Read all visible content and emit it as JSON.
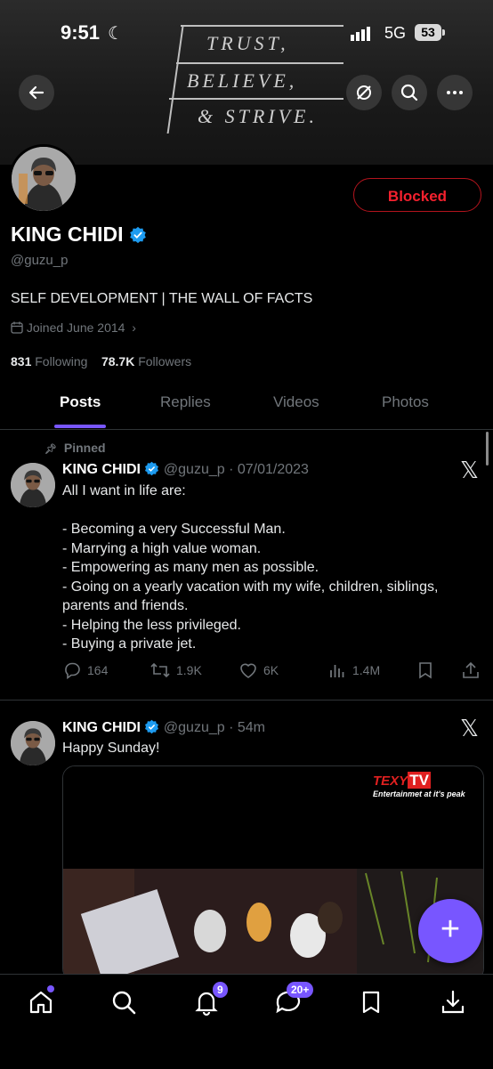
{
  "status_bar": {
    "time": "9:51",
    "network": "5G",
    "battery": "53"
  },
  "banner": {
    "lines": [
      "TRUST,",
      "BELIEVE,",
      "& STRIVE."
    ]
  },
  "header": {
    "back_icon": "arrow-left-icon",
    "actions": [
      "mute-icon",
      "search-icon",
      "more-icon"
    ]
  },
  "profile": {
    "name": "KING CHIDI",
    "handle": "@guzu_p",
    "bio": "SELF DEVELOPMENT | THE WALL OF FACTS",
    "joined": "Joined June 2014",
    "following_count": "831",
    "following_label": "Following",
    "followers_count": "78.7K",
    "followers_label": "Followers",
    "blocked_label": "Blocked"
  },
  "tabs": [
    {
      "label": "Posts",
      "active": true
    },
    {
      "label": "Replies",
      "active": false
    },
    {
      "label": "Videos",
      "active": false
    },
    {
      "label": "Photos",
      "active": false
    }
  ],
  "posts": [
    {
      "pinned_label": "Pinned",
      "author": "KING CHIDI",
      "handle": "@guzu_p",
      "time": "· 07/01/2023",
      "text": "All I want in life are:\n\n- Becoming a very Successful Man.\n- Marrying a high value woman.\n- Empowering as many men as possible.\n- Going on a yearly vacation with my wife, children, siblings, parents and friends.\n- Helping the less privileged.\n- Buying a private jet.",
      "replies": "164",
      "reposts": "1.9K",
      "likes": "6K",
      "views": "1.4M"
    },
    {
      "author": "KING CHIDI",
      "handle": "@guzu_p",
      "time": "· 54m",
      "text": "Happy Sunday!",
      "media_brand": "TEXY",
      "media_brand_tv": "TV",
      "media_tagline": "Entertainmet at it's peak"
    }
  ],
  "bottom_nav": {
    "notifications_badge": "9",
    "messages_badge": "20+"
  },
  "colors": {
    "accent": "#7856ff",
    "blocked": "#f4212e",
    "verified": "#1d9bf0"
  }
}
